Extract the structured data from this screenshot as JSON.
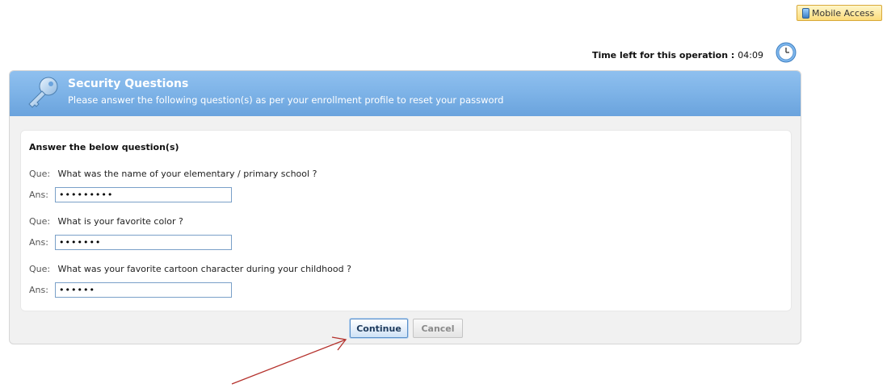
{
  "mobile_access": {
    "label": "Mobile Access",
    "icon": "phone-icon"
  },
  "timer": {
    "label": "Time left for this operation :",
    "value": "04:09",
    "icon": "clock-icon"
  },
  "panel": {
    "title": "Security Questions",
    "subtitle": "Please answer the following question(s) as per your enrollment profile to reset your password",
    "icon": "key-icon",
    "section_title": "Answer the below question(s)",
    "que_tag": "Que:",
    "ans_tag": "Ans:",
    "questions": [
      {
        "question": "What was the name of your elementary / primary school ?",
        "answer": "•••••••••"
      },
      {
        "question": "What is your favorite color ?",
        "answer": "•••••••"
      },
      {
        "question": "What was your favorite cartoon character during your childhood ?",
        "answer": "••••••"
      }
    ]
  },
  "buttons": {
    "continue": "Continue",
    "cancel": "Cancel"
  },
  "colors": {
    "header_blue": "#7fb4e8",
    "annotation_arrow": "#b5322d"
  }
}
